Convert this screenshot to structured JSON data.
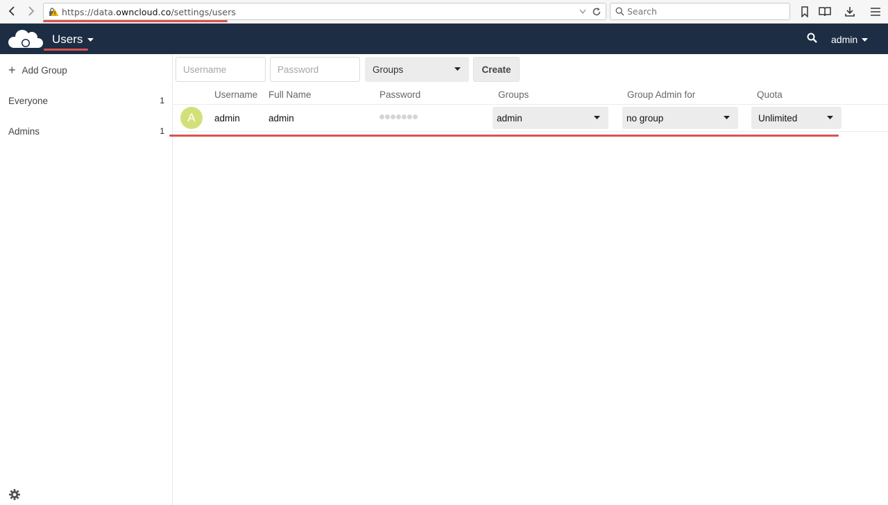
{
  "browser": {
    "url_prefix": "https://data.",
    "url_domain": "owncloud.co",
    "url_path": "/settings/users",
    "search_placeholder": "Search"
  },
  "header": {
    "app_name": "Users",
    "user_menu": "admin"
  },
  "sidebar": {
    "add_group_label": "Add Group",
    "groups": [
      {
        "name": "Everyone",
        "count": "1"
      },
      {
        "name": "Admins",
        "count": "1"
      }
    ]
  },
  "create_form": {
    "username_placeholder": "Username",
    "password_placeholder": "Password",
    "groups_select": "Groups",
    "create_button": "Create"
  },
  "table": {
    "columns": [
      "Username",
      "Full Name",
      "Password",
      "Groups",
      "Group Admin for",
      "Quota"
    ],
    "rows": [
      {
        "avatar_letter": "A",
        "username": "admin",
        "full_name": "admin",
        "groups": "admin",
        "group_admin_for": "no group",
        "quota": "Unlimited"
      }
    ]
  },
  "colors": {
    "header_bg": "#1d2d44",
    "avatar_bg": "#d3e07a",
    "annotation_red": "#d9534f"
  }
}
